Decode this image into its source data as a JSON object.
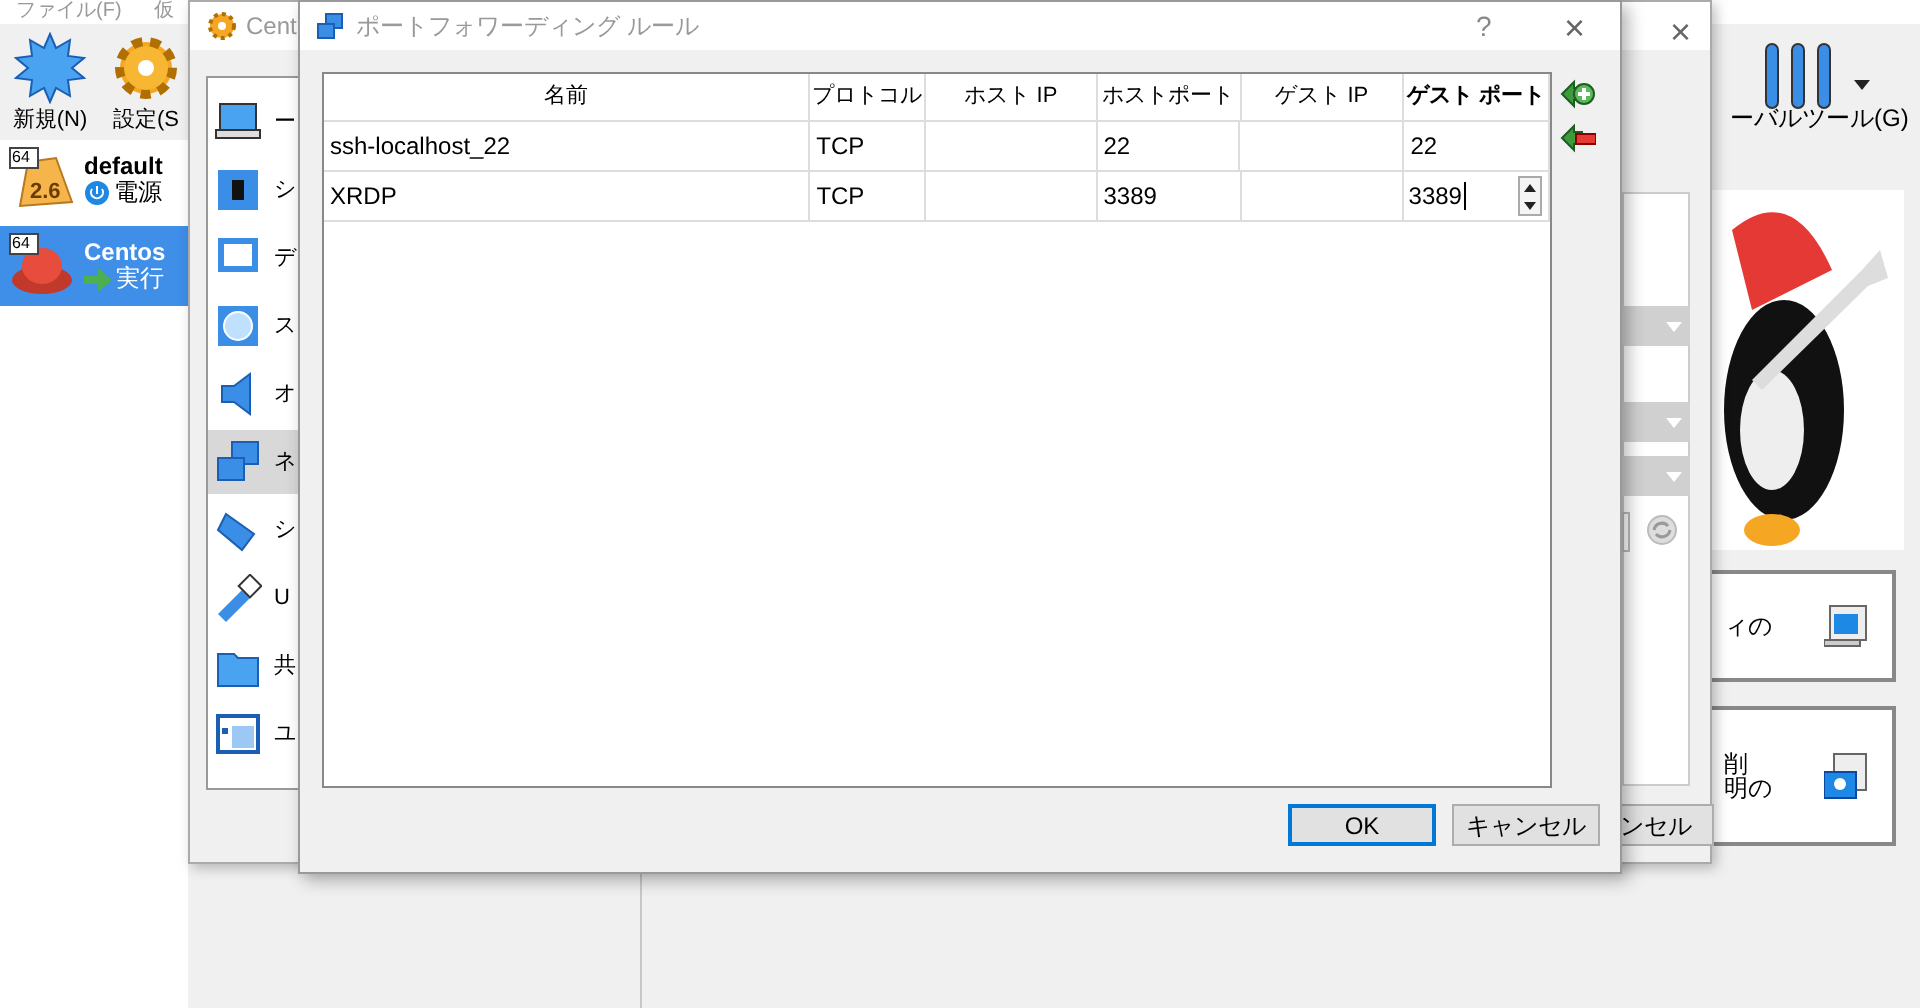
{
  "main_window": {
    "menu": [
      "ファイル(F)",
      "仮"
    ],
    "toolbar": [
      {
        "label": "新規(N)",
        "kind": "new"
      },
      {
        "label": "設定(S",
        "kind": "settings"
      }
    ],
    "global_tools": "ーバルツール(G)",
    "vms": [
      {
        "name": "default",
        "state": "電源",
        "arch": "64",
        "version": "2.6",
        "kind": "powered-off",
        "selected": false
      },
      {
        "name": "Centos",
        "state": "実行",
        "arch": "64",
        "kind": "running",
        "selected": true
      }
    ],
    "cards": [
      {
        "lines": [
          "ィの"
        ],
        "kind": "monitor"
      },
      {
        "lines": [
          "削",
          "明の"
        ],
        "kind": "camera"
      }
    ]
  },
  "settings_dialog": {
    "title": "Cent",
    "close": "×",
    "sections": [
      {
        "label": "ー",
        "kind": "laptop",
        "selected": false
      },
      {
        "label": "シ",
        "kind": "chip",
        "selected": false
      },
      {
        "label": "デ",
        "kind": "display",
        "selected": false
      },
      {
        "label": "ス",
        "kind": "disk",
        "selected": false
      },
      {
        "label": "オ",
        "kind": "speaker",
        "selected": false
      },
      {
        "label": "ネ",
        "kind": "network",
        "selected": true
      },
      {
        "label": "シ",
        "kind": "serial",
        "selected": false
      },
      {
        "label": "U",
        "kind": "usb",
        "selected": false
      },
      {
        "label": "共",
        "kind": "folder",
        "selected": false
      },
      {
        "label": "ユ",
        "kind": "window",
        "selected": false
      }
    ],
    "cancel": "ンセル"
  },
  "port_forwarding": {
    "title": "ポートフォワーディング ルール",
    "help": "?",
    "close": "×",
    "columns": [
      {
        "label": "名前",
        "active": false
      },
      {
        "label": "プロトコル",
        "active": false
      },
      {
        "label": "ホスト IP",
        "active": false
      },
      {
        "label": "ホストポート",
        "active": false
      },
      {
        "label": "ゲスト IP",
        "active": false
      },
      {
        "label": "ゲスト ポート",
        "active": true
      }
    ],
    "rows": [
      {
        "cells": [
          "ssh-localhost_22",
          "TCP",
          "",
          "22",
          "",
          "22"
        ],
        "editing": false
      },
      {
        "cells": [
          "XRDP",
          "TCP",
          "",
          "3389",
          "",
          "3389"
        ],
        "editing": true
      }
    ],
    "buttons": [
      {
        "label": "OK",
        "default": true
      },
      {
        "label": "キャンセル",
        "default": false
      }
    ]
  }
}
